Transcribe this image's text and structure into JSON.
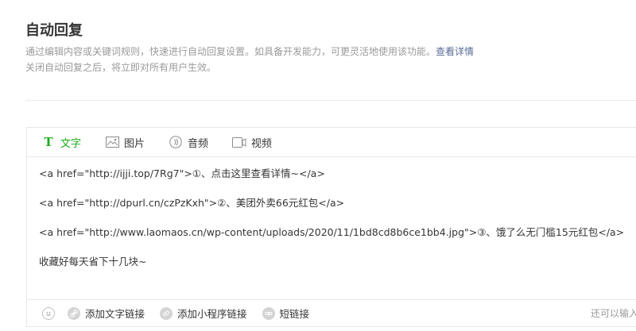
{
  "header": {
    "title": "自动回复",
    "desc_line1": "通过编辑内容或关键词规则，快速进行自动回复设置。如具备开发能力，可更灵活地使用该功能。",
    "details_link": "查看详情",
    "desc_line2": "关闭自动回复之后，将立即对所有用户生效。"
  },
  "tabs": [
    {
      "label": "文字",
      "icon": "text-icon",
      "active": true
    },
    {
      "label": "图片",
      "icon": "image-icon"
    },
    {
      "label": "音频",
      "icon": "audio-icon"
    },
    {
      "label": "视频",
      "icon": "video-icon"
    }
  ],
  "content": {
    "lines": [
      "<a href=\"http://ijji.top/7Rg7\">①、点击这里查看详情~</a>",
      "<a href=\"http://dpurl.cn/czPzKxh\">②、美团外卖66元红包</a>",
      "<a href=\"http://www.laomaos.cn/wp-content/uploads/2020/11/1bd8cd8b6ce1bb4.jpg\">③、饿了么无门槛15元红包</a>",
      "收藏好每天省下十几块~"
    ]
  },
  "footer": {
    "add_text_link": "添加文字链接",
    "add_miniprogram_link": "添加小程序链接",
    "short_link": "短链接",
    "counter": "还可以输入"
  },
  "colors": {
    "accent_green": "#1aad19",
    "link_blue": "#576b95",
    "muted": "#9a9a9a"
  }
}
